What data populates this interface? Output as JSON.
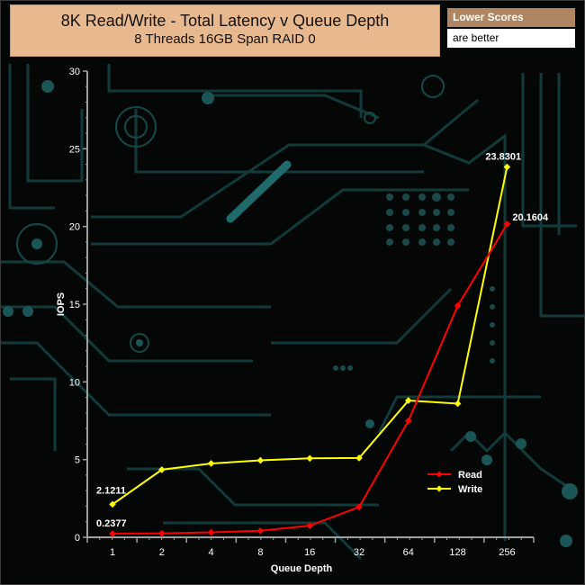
{
  "header": {
    "title": "8K Read/Write - Total Latency v Queue Depth",
    "subtitle": "8 Threads 16GB Span RAID 0"
  },
  "note": {
    "heading": "Lower Scores",
    "body": "are better"
  },
  "colors": {
    "read": "#ff0000",
    "write": "#ffff00",
    "axis": "#a0a0a0",
    "title_bg": "#e8b98f",
    "note_bg": "#b08662"
  },
  "chart_data": {
    "type": "line",
    "categories": [
      "1",
      "2",
      "4",
      "8",
      "16",
      "32",
      "64",
      "128",
      "256"
    ],
    "xlabel": "Queue Depth",
    "ylabel": "IOPS",
    "ylim": [
      0,
      30
    ],
    "yticks": [
      "0",
      "5",
      "10",
      "15",
      "20",
      "25",
      "30"
    ],
    "grid": false,
    "legend_position": "lower-right",
    "series": [
      {
        "name": "Read",
        "color": "#ff0000",
        "values": [
          0.2377,
          0.25,
          0.32,
          0.42,
          0.75,
          1.95,
          7.5,
          14.9,
          20.1604
        ]
      },
      {
        "name": "Write",
        "color": "#ffff00",
        "values": [
          2.1211,
          4.35,
          4.75,
          4.95,
          5.08,
          5.1,
          8.8,
          8.6,
          23.8301
        ]
      }
    ],
    "data_labels": [
      {
        "series": 0,
        "index": 0,
        "text": "0.2377"
      },
      {
        "series": 1,
        "index": 0,
        "text": "2.1211"
      },
      {
        "series": 0,
        "index": 8,
        "text": "20.1604"
      },
      {
        "series": 1,
        "index": 8,
        "text": "23.8301"
      }
    ]
  }
}
